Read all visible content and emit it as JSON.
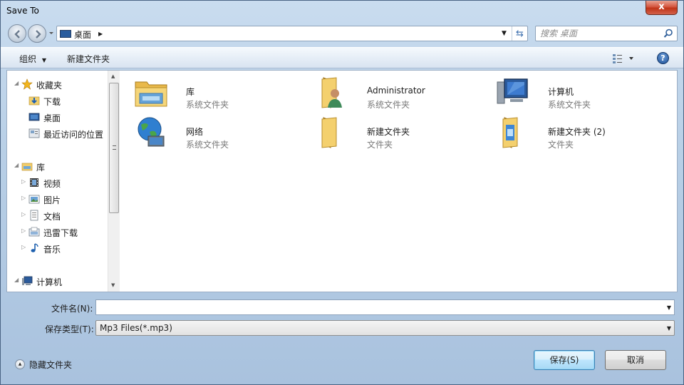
{
  "window": {
    "title": "Save To",
    "close_symbol": "x"
  },
  "address_bar": {
    "location": "桌面"
  },
  "search": {
    "placeholder": "搜索 桌面"
  },
  "toolbar": {
    "organize_label": "组织",
    "new_folder_label": "新建文件夹"
  },
  "nav_pane": {
    "items": [
      {
        "label": "收藏夹",
        "icon": "star-icon"
      },
      {
        "label": "下载",
        "icon": "download-folder-icon"
      },
      {
        "label": "桌面",
        "icon": "desktop-icon"
      },
      {
        "label": "最近访问的位置",
        "icon": "recent-places-icon"
      },
      {
        "label": "库",
        "icon": "library-icon"
      },
      {
        "label": "视频",
        "icon": "video-icon"
      },
      {
        "label": "图片",
        "icon": "pictures-icon"
      },
      {
        "label": "文档",
        "icon": "documents-icon"
      },
      {
        "label": "迅雷下载",
        "icon": "thunder-download-icon"
      },
      {
        "label": "音乐",
        "icon": "music-icon"
      },
      {
        "label": "计算机",
        "icon": "computer-icon"
      }
    ]
  },
  "files": [
    {
      "name": "库",
      "type": "系统文件夹",
      "icon": "library-icon"
    },
    {
      "name": "Administrator",
      "type": "系统文件夹",
      "icon": "user-folder-icon"
    },
    {
      "name": "计算机",
      "type": "系统文件夹",
      "icon": "computer-icon"
    },
    {
      "name": "网络",
      "type": "系统文件夹",
      "icon": "network-icon"
    },
    {
      "name": "新建文件夹",
      "type": "文件夹",
      "icon": "folder-icon"
    },
    {
      "name": "新建文件夹 (2)",
      "type": "文件夹",
      "icon": "folder-icon"
    }
  ],
  "form": {
    "filename_label": "文件名(N):",
    "filename_value": "",
    "filetype_label": "保存类型(T):",
    "filetype_value": "Mp3 Files(*.mp3)"
  },
  "footer": {
    "hide_folders_label": "隐藏文件夹",
    "save_label": "保存(S)",
    "cancel_label": "取消"
  }
}
